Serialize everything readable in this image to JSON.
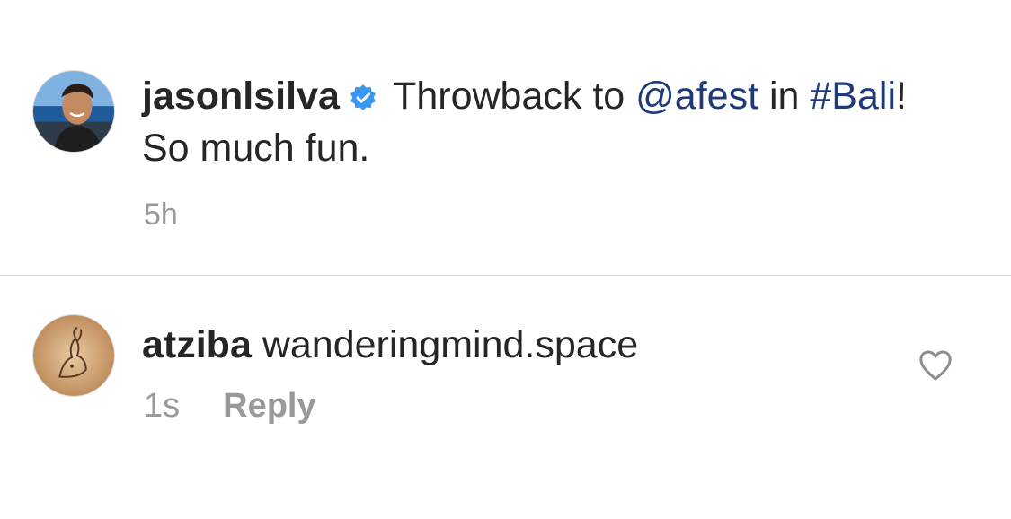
{
  "caption": {
    "username": "jasonlsilva",
    "text_part1": " Throwback to ",
    "mention": "@afest",
    "text_part2": " in ",
    "hashtag": "#Bali",
    "text_part3": "! So much fun.",
    "time": "5h",
    "avatar_icon": "profile-photo-beach",
    "verified_icon": "verified-badge-icon"
  },
  "comment": {
    "username": "atziba",
    "text": " wanderingmind.space",
    "time": "1s",
    "reply_label": "Reply",
    "avatar_icon": "profile-photo-sketch",
    "like_icon": "heart-outline-icon"
  },
  "colors": {
    "text": "#262626",
    "muted": "#999999",
    "link": "#1f3a78",
    "verified": "#3897f0",
    "divider": "#dbdbdb"
  }
}
